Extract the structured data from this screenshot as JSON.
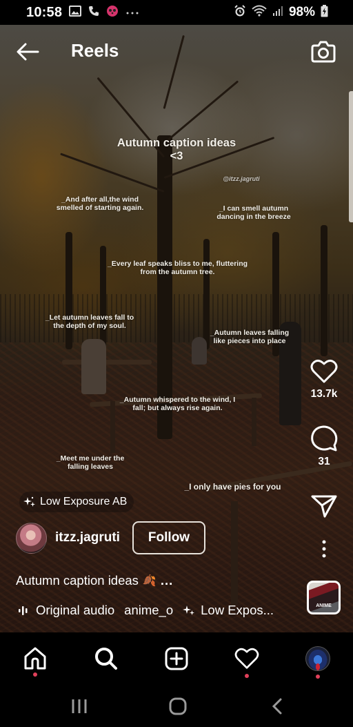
{
  "status_bar": {
    "time": "10:58",
    "left_icons": [
      "gallery-icon",
      "phone-icon",
      "foodpanda-icon",
      "more-dots-icon"
    ],
    "right_icons": [
      "alarm-icon",
      "wifi-icon",
      "signal-icon"
    ],
    "battery_percent": "98%",
    "battery_charging": true
  },
  "header": {
    "title": "Reels",
    "back_icon": "arrow-left-icon",
    "camera_icon": "camera-icon"
  },
  "video_overlay": {
    "title_line1": "Autumn caption ideas",
    "title_line2": "<3",
    "watermark": "@itzz.jagruti",
    "captions": [
      {
        "line1": "_And after all,the wind",
        "line2": "smelled of starting again."
      },
      {
        "line1": "_I can smell autumn",
        "line2": "dancing in the breeze"
      },
      {
        "line1": "_Every leaf speaks bliss to me, fluttering",
        "line2": "from the autumn tree."
      },
      {
        "line1": "_Let autumn leaves fall to",
        "line2": "the depth of my soul."
      },
      {
        "line1": "_Autumn leaves falling",
        "line2": "like pieces into place"
      },
      {
        "line1": "_Autumn whispered to the wind, I",
        "line2": "fall; but always rise again."
      },
      {
        "line1": "_Meet me under the",
        "line2": "falling leaves"
      },
      {
        "line1": "_I only have pies for you",
        "line2": ""
      }
    ]
  },
  "actions": {
    "like_count": "13.7k",
    "comment_count": "31"
  },
  "effect": {
    "label": "Low Exposure AB"
  },
  "author": {
    "username": "itzz.jagruti",
    "follow_label": "Follow"
  },
  "caption": {
    "text": "Autumn caption ideas",
    "emoji": "🍂",
    "more": "..."
  },
  "audio": {
    "original_audio": "Original audio",
    "artist": "anime_o",
    "effect": "Low Expos..."
  },
  "audio_thumb": {
    "label": "ANIME"
  },
  "bottom_nav": {
    "items": [
      {
        "name": "home",
        "has_dot": true
      },
      {
        "name": "search",
        "has_dot": false
      },
      {
        "name": "create",
        "has_dot": false
      },
      {
        "name": "activity",
        "has_dot": true
      },
      {
        "name": "profile",
        "has_dot": true
      }
    ],
    "dot_color": "#e0405a"
  },
  "system_nav": {
    "buttons": [
      "recent-apps",
      "home",
      "back"
    ]
  }
}
